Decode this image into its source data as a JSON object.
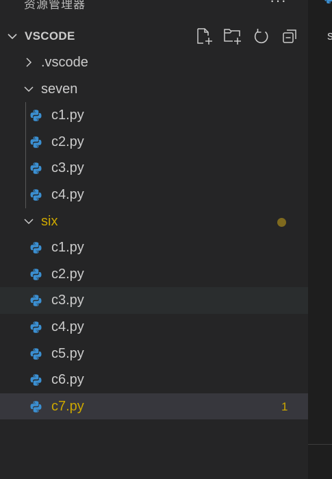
{
  "explorer": {
    "title": "资源管理器",
    "more_actions": "···"
  },
  "section": {
    "title": "VSCODE",
    "actions": [
      {
        "name": "new-file-icon"
      },
      {
        "name": "new-folder-icon"
      },
      {
        "name": "refresh-icon"
      },
      {
        "name": "collapse-all-icon"
      }
    ]
  },
  "tree": {
    "folders": [
      {
        "label": ".vscode",
        "expanded": false
      },
      {
        "label": "seven",
        "expanded": true
      },
      {
        "label": "six",
        "expanded": true,
        "status": "warning"
      }
    ],
    "seven_files": [
      "c1.py",
      "c2.py",
      "c3.py",
      "c4.py"
    ],
    "six_files": [
      "c1.py",
      "c2.py",
      "c3.py",
      "c4.py",
      "c5.py",
      "c6.py",
      "c7.py"
    ],
    "c7_problem_count": "1"
  },
  "editor": {
    "tab_text": "s"
  },
  "colors": {
    "sidebar_bg": "#252526",
    "editor_bg": "#1e1e1e",
    "text": "#cccccc",
    "warning": "#cca700",
    "selected_row": "#37373d",
    "hover_row": "#2a2d2e",
    "python_blue": "#3b8fd1",
    "python_yellow": "#f5c93d"
  }
}
